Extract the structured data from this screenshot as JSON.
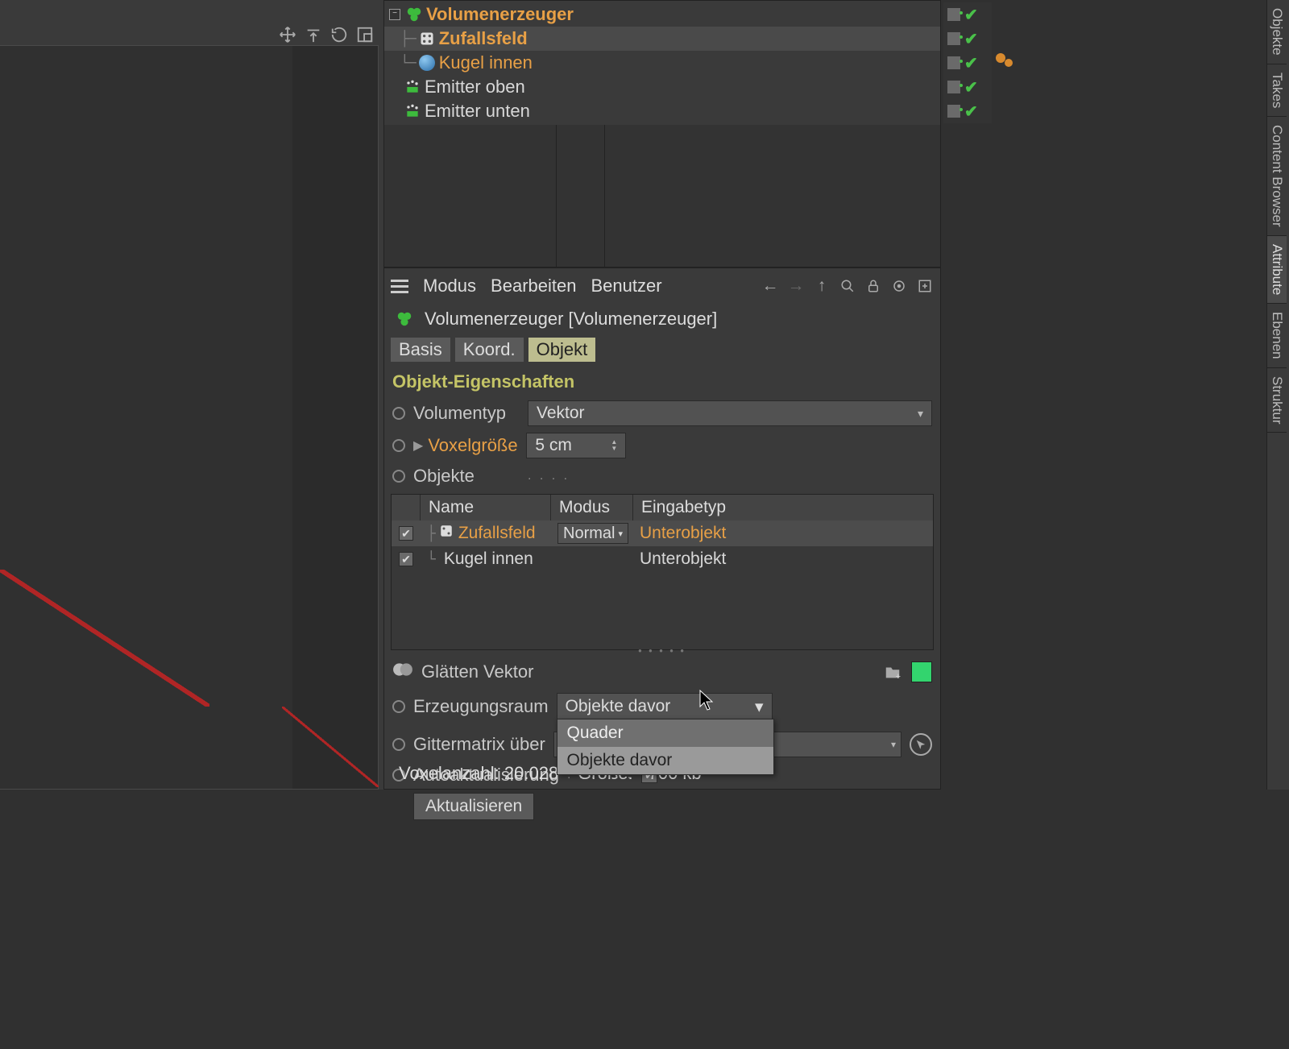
{
  "colors": {
    "orange": "#e8a046",
    "green": "#4ac14a",
    "accent": "#bdbd8f"
  },
  "tree": {
    "items": [
      {
        "label": "Volumenerzeuger",
        "style": "orange-bold",
        "icon": "volume-builder"
      },
      {
        "label": "Zufallsfeld",
        "style": "orange-bold",
        "icon": "random-field"
      },
      {
        "label": "Kugel innen",
        "style": "orange",
        "icon": "sphere",
        "tags": "spheres"
      },
      {
        "label": "Emitter oben",
        "style": "white",
        "icon": "emitter"
      },
      {
        "label": "Emitter unten",
        "style": "white",
        "icon": "emitter"
      }
    ]
  },
  "vtabs": [
    "Objekte",
    "Takes",
    "Content Browser",
    "Attribute",
    "Ebenen",
    "Struktur"
  ],
  "attr": {
    "menu": {
      "modus": "Modus",
      "bearbeiten": "Bearbeiten",
      "benutzer": "Benutzer"
    },
    "title": "Volumenerzeuger [Volumenerzeuger]",
    "tabs": {
      "basis": "Basis",
      "koord": "Koord.",
      "objekt": "Objekt"
    },
    "section": "Objekt-Eigenschaften",
    "volumentyp": {
      "label": "Volumentyp",
      "value": "Vektor"
    },
    "voxelgroesse": {
      "label": "Voxelgröße",
      "value": "5 cm"
    },
    "objekte": {
      "label": "Objekte"
    },
    "table": {
      "headers": {
        "name": "Name",
        "modus": "Modus",
        "eingabetyp": "Eingabetyp"
      },
      "rows": [
        {
          "name": "Zufallsfeld",
          "style": "orange",
          "modus": "Normal",
          "eingabetyp": "Unterobjekt",
          "etype_style": "orange",
          "icon": "random-field"
        },
        {
          "name": "Kugel innen",
          "style": "white",
          "modus": "",
          "eingabetyp": "Unterobjekt",
          "etype_style": "white",
          "icon": "sphere"
        }
      ]
    },
    "glatten": "Glätten Vektor",
    "erzeugungsraum": {
      "label": "Erzeugungsraum",
      "value": "Objekte davor",
      "options": [
        "Quader",
        "Objekte davor"
      ]
    },
    "gittermatrix": {
      "label": "Gittermatrix über"
    },
    "autoaktualisierung": {
      "label": "Autoaktualisierung"
    },
    "aktualisieren": "Aktualisieren"
  },
  "status": {
    "voxel": "Voxelanzahl: 20.028",
    "size": "Größe: ~700 kb"
  }
}
